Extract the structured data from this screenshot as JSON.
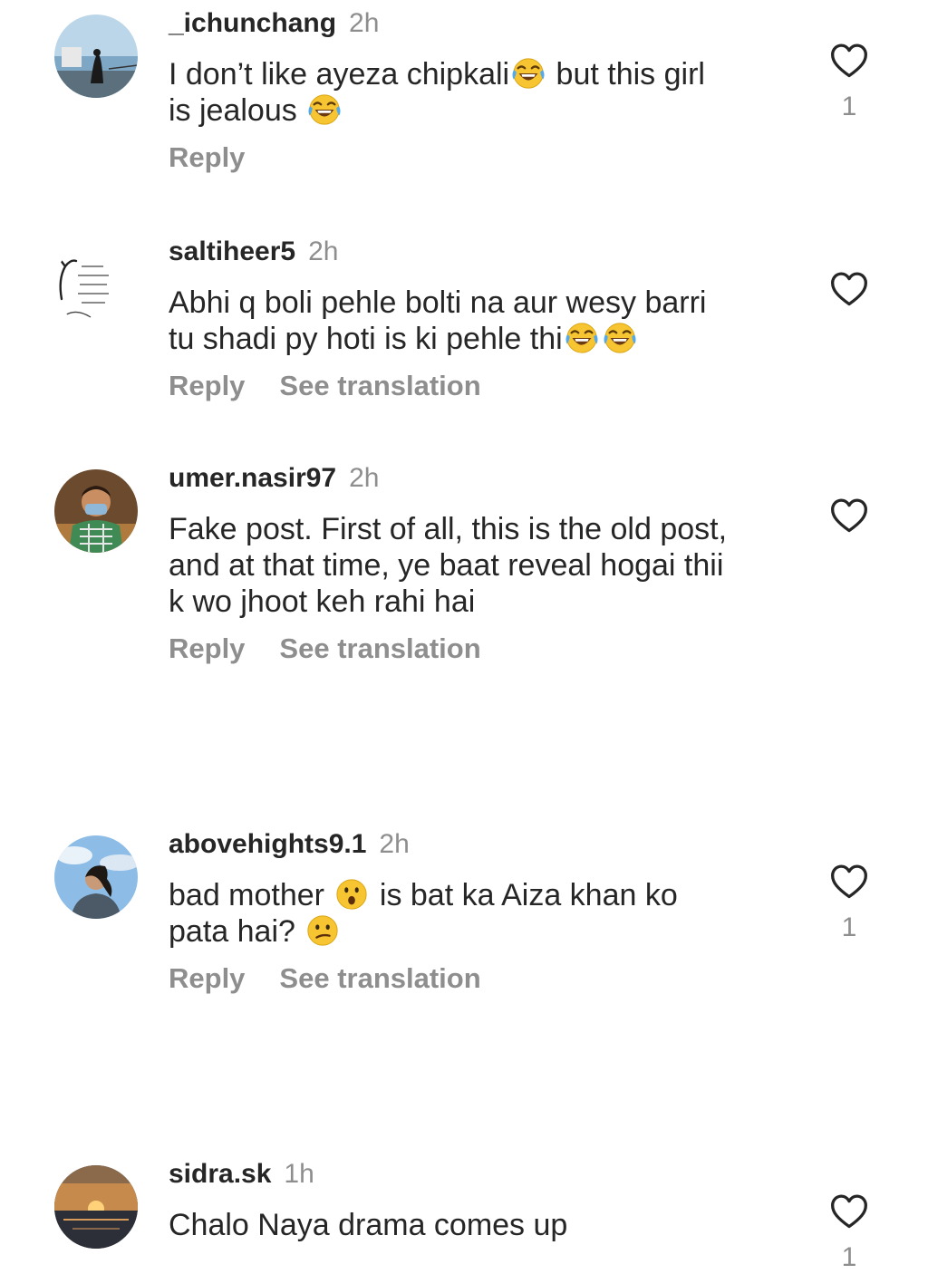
{
  "comments": [
    {
      "username": "_ichunchang",
      "time": "2h",
      "text_lines": [
        "I don’t like ayeza chipkali",
        " but this girl",
        "is jealous "
      ],
      "reply_label": "Reply",
      "like_count": "1"
    },
    {
      "username": "saltiheer5",
      "time": "2h",
      "text_lines": [
        "Abhi q boli pehle bolti na aur wesy barri",
        "tu shadi py hoti is ki pehle thi"
      ],
      "reply_label": "Reply",
      "translation_label": "See translation"
    },
    {
      "username": "umer.nasir97",
      "time": "2h",
      "text_lines": [
        "Fake post. First of all, this is the old post,",
        "and at that time, ye baat reveal hogai thii",
        "k wo jhoot keh rahi hai"
      ],
      "reply_label": "Reply",
      "translation_label": "See translation"
    },
    {
      "username": "abovehights9.1",
      "time": "2h",
      "text_lines": [
        "bad mother ",
        " is bat ka Aiza khan ko",
        "pata hai? "
      ],
      "reply_label": "Reply",
      "translation_label": "See translation",
      "like_count": "1"
    },
    {
      "username": "sidra.sk",
      "time": "1h",
      "text_lines": [
        "Chalo Naya drama comes up"
      ],
      "like_count": "1"
    }
  ],
  "icons": {
    "like": "heart-outline-icon",
    "laugh_emoji": "face-with-tears-of-joy-emoji",
    "surprised_emoji": "hushed-face-emoji",
    "confused_emoji": "confused-face-emoji"
  },
  "colors": {
    "text": "#262626",
    "secondary": "#8e8e8e",
    "background": "#ffffff"
  }
}
